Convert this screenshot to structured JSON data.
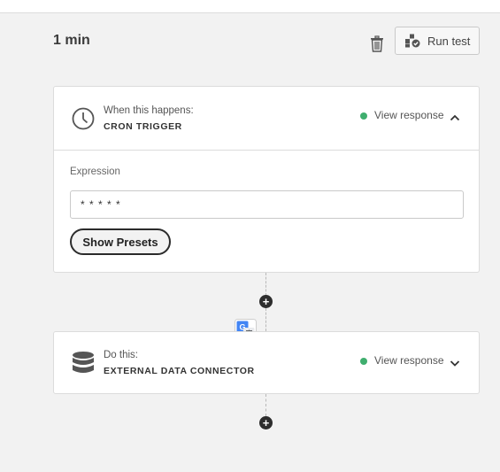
{
  "header": {
    "title": "1 min",
    "run_test_label": "Run test"
  },
  "steps": [
    {
      "label": "When this happens:",
      "name": "CRON TRIGGER",
      "view_response": "View response",
      "status_color": "#3fae6e",
      "icon": "clock-icon",
      "expanded": true,
      "expression_label": "Expression",
      "expression_value": "* * * * *",
      "presets_label": "Show Presets"
    },
    {
      "label": "Do this:",
      "name": "EXTERNAL DATA CONNECTOR",
      "view_response": "View response",
      "status_color": "#3fae6e",
      "icon": "database-icon",
      "expanded": false
    }
  ],
  "colors": {
    "background": "#f2f2f2",
    "card": "#ffffff",
    "border": "#dcdcdc",
    "status_ok": "#3fae6e",
    "translate_blue": "#4285f4"
  }
}
